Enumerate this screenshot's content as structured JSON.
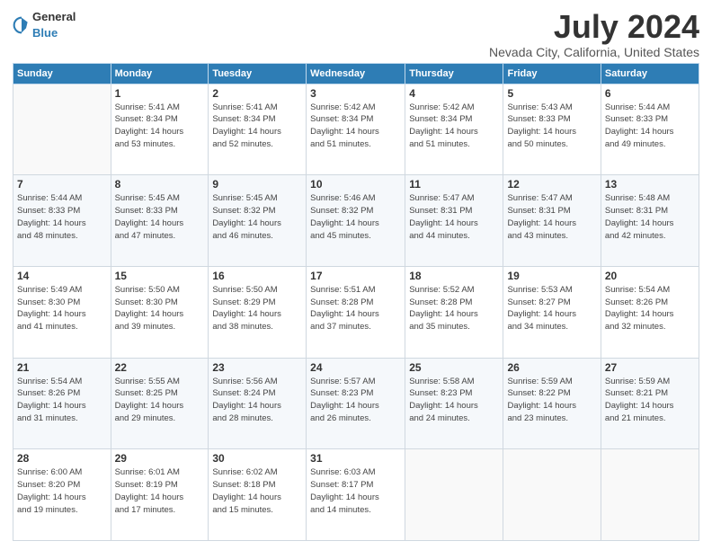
{
  "logo": {
    "general": "General",
    "blue": "Blue"
  },
  "header": {
    "title": "July 2024",
    "subtitle": "Nevada City, California, United States"
  },
  "weekdays": [
    "Sunday",
    "Monday",
    "Tuesday",
    "Wednesday",
    "Thursday",
    "Friday",
    "Saturday"
  ],
  "weeks": [
    [
      {
        "day": "",
        "info": ""
      },
      {
        "day": "1",
        "info": "Sunrise: 5:41 AM\nSunset: 8:34 PM\nDaylight: 14 hours\nand 53 minutes."
      },
      {
        "day": "2",
        "info": "Sunrise: 5:41 AM\nSunset: 8:34 PM\nDaylight: 14 hours\nand 52 minutes."
      },
      {
        "day": "3",
        "info": "Sunrise: 5:42 AM\nSunset: 8:34 PM\nDaylight: 14 hours\nand 51 minutes."
      },
      {
        "day": "4",
        "info": "Sunrise: 5:42 AM\nSunset: 8:34 PM\nDaylight: 14 hours\nand 51 minutes."
      },
      {
        "day": "5",
        "info": "Sunrise: 5:43 AM\nSunset: 8:33 PM\nDaylight: 14 hours\nand 50 minutes."
      },
      {
        "day": "6",
        "info": "Sunrise: 5:44 AM\nSunset: 8:33 PM\nDaylight: 14 hours\nand 49 minutes."
      }
    ],
    [
      {
        "day": "7",
        "info": "Sunrise: 5:44 AM\nSunset: 8:33 PM\nDaylight: 14 hours\nand 48 minutes."
      },
      {
        "day": "8",
        "info": "Sunrise: 5:45 AM\nSunset: 8:33 PM\nDaylight: 14 hours\nand 47 minutes."
      },
      {
        "day": "9",
        "info": "Sunrise: 5:45 AM\nSunset: 8:32 PM\nDaylight: 14 hours\nand 46 minutes."
      },
      {
        "day": "10",
        "info": "Sunrise: 5:46 AM\nSunset: 8:32 PM\nDaylight: 14 hours\nand 45 minutes."
      },
      {
        "day": "11",
        "info": "Sunrise: 5:47 AM\nSunset: 8:31 PM\nDaylight: 14 hours\nand 44 minutes."
      },
      {
        "day": "12",
        "info": "Sunrise: 5:47 AM\nSunset: 8:31 PM\nDaylight: 14 hours\nand 43 minutes."
      },
      {
        "day": "13",
        "info": "Sunrise: 5:48 AM\nSunset: 8:31 PM\nDaylight: 14 hours\nand 42 minutes."
      }
    ],
    [
      {
        "day": "14",
        "info": "Sunrise: 5:49 AM\nSunset: 8:30 PM\nDaylight: 14 hours\nand 41 minutes."
      },
      {
        "day": "15",
        "info": "Sunrise: 5:50 AM\nSunset: 8:30 PM\nDaylight: 14 hours\nand 39 minutes."
      },
      {
        "day": "16",
        "info": "Sunrise: 5:50 AM\nSunset: 8:29 PM\nDaylight: 14 hours\nand 38 minutes."
      },
      {
        "day": "17",
        "info": "Sunrise: 5:51 AM\nSunset: 8:28 PM\nDaylight: 14 hours\nand 37 minutes."
      },
      {
        "day": "18",
        "info": "Sunrise: 5:52 AM\nSunset: 8:28 PM\nDaylight: 14 hours\nand 35 minutes."
      },
      {
        "day": "19",
        "info": "Sunrise: 5:53 AM\nSunset: 8:27 PM\nDaylight: 14 hours\nand 34 minutes."
      },
      {
        "day": "20",
        "info": "Sunrise: 5:54 AM\nSunset: 8:26 PM\nDaylight: 14 hours\nand 32 minutes."
      }
    ],
    [
      {
        "day": "21",
        "info": "Sunrise: 5:54 AM\nSunset: 8:26 PM\nDaylight: 14 hours\nand 31 minutes."
      },
      {
        "day": "22",
        "info": "Sunrise: 5:55 AM\nSunset: 8:25 PM\nDaylight: 14 hours\nand 29 minutes."
      },
      {
        "day": "23",
        "info": "Sunrise: 5:56 AM\nSunset: 8:24 PM\nDaylight: 14 hours\nand 28 minutes."
      },
      {
        "day": "24",
        "info": "Sunrise: 5:57 AM\nSunset: 8:23 PM\nDaylight: 14 hours\nand 26 minutes."
      },
      {
        "day": "25",
        "info": "Sunrise: 5:58 AM\nSunset: 8:23 PM\nDaylight: 14 hours\nand 24 minutes."
      },
      {
        "day": "26",
        "info": "Sunrise: 5:59 AM\nSunset: 8:22 PM\nDaylight: 14 hours\nand 23 minutes."
      },
      {
        "day": "27",
        "info": "Sunrise: 5:59 AM\nSunset: 8:21 PM\nDaylight: 14 hours\nand 21 minutes."
      }
    ],
    [
      {
        "day": "28",
        "info": "Sunrise: 6:00 AM\nSunset: 8:20 PM\nDaylight: 14 hours\nand 19 minutes."
      },
      {
        "day": "29",
        "info": "Sunrise: 6:01 AM\nSunset: 8:19 PM\nDaylight: 14 hours\nand 17 minutes."
      },
      {
        "day": "30",
        "info": "Sunrise: 6:02 AM\nSunset: 8:18 PM\nDaylight: 14 hours\nand 15 minutes."
      },
      {
        "day": "31",
        "info": "Sunrise: 6:03 AM\nSunset: 8:17 PM\nDaylight: 14 hours\nand 14 minutes."
      },
      {
        "day": "",
        "info": ""
      },
      {
        "day": "",
        "info": ""
      },
      {
        "day": "",
        "info": ""
      }
    ]
  ]
}
